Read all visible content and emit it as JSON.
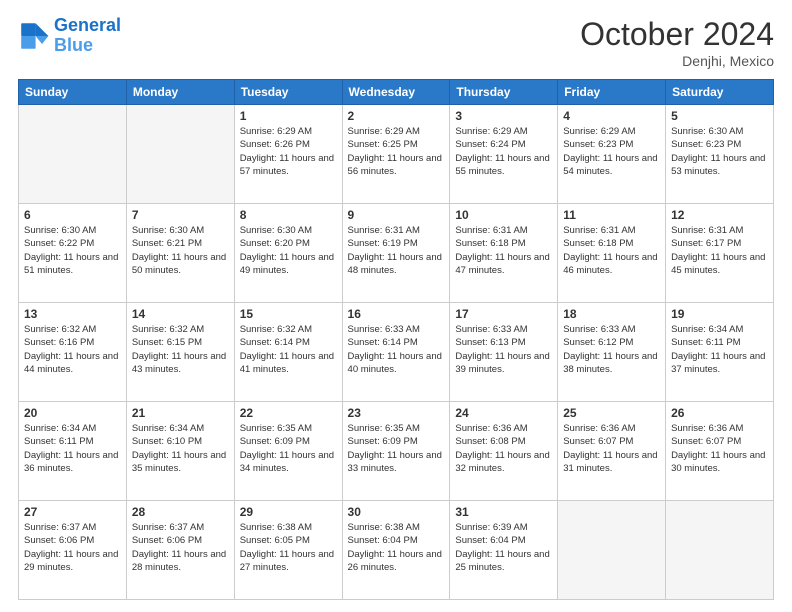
{
  "header": {
    "logo_line1": "General",
    "logo_line2": "Blue",
    "month": "October 2024",
    "location": "Denjhi, Mexico"
  },
  "weekdays": [
    "Sunday",
    "Monday",
    "Tuesday",
    "Wednesday",
    "Thursday",
    "Friday",
    "Saturday"
  ],
  "weeks": [
    [
      {
        "day": "",
        "empty": true
      },
      {
        "day": "",
        "empty": true
      },
      {
        "day": "1",
        "sunrise": "6:29 AM",
        "sunset": "6:26 PM",
        "daylight": "11 hours and 57 minutes."
      },
      {
        "day": "2",
        "sunrise": "6:29 AM",
        "sunset": "6:25 PM",
        "daylight": "11 hours and 56 minutes."
      },
      {
        "day": "3",
        "sunrise": "6:29 AM",
        "sunset": "6:24 PM",
        "daylight": "11 hours and 55 minutes."
      },
      {
        "day": "4",
        "sunrise": "6:29 AM",
        "sunset": "6:23 PM",
        "daylight": "11 hours and 54 minutes."
      },
      {
        "day": "5",
        "sunrise": "6:30 AM",
        "sunset": "6:23 PM",
        "daylight": "11 hours and 53 minutes."
      }
    ],
    [
      {
        "day": "6",
        "sunrise": "6:30 AM",
        "sunset": "6:22 PM",
        "daylight": "11 hours and 51 minutes."
      },
      {
        "day": "7",
        "sunrise": "6:30 AM",
        "sunset": "6:21 PM",
        "daylight": "11 hours and 50 minutes."
      },
      {
        "day": "8",
        "sunrise": "6:30 AM",
        "sunset": "6:20 PM",
        "daylight": "11 hours and 49 minutes."
      },
      {
        "day": "9",
        "sunrise": "6:31 AM",
        "sunset": "6:19 PM",
        "daylight": "11 hours and 48 minutes."
      },
      {
        "day": "10",
        "sunrise": "6:31 AM",
        "sunset": "6:18 PM",
        "daylight": "11 hours and 47 minutes."
      },
      {
        "day": "11",
        "sunrise": "6:31 AM",
        "sunset": "6:18 PM",
        "daylight": "11 hours and 46 minutes."
      },
      {
        "day": "12",
        "sunrise": "6:31 AM",
        "sunset": "6:17 PM",
        "daylight": "11 hours and 45 minutes."
      }
    ],
    [
      {
        "day": "13",
        "sunrise": "6:32 AM",
        "sunset": "6:16 PM",
        "daylight": "11 hours and 44 minutes."
      },
      {
        "day": "14",
        "sunrise": "6:32 AM",
        "sunset": "6:15 PM",
        "daylight": "11 hours and 43 minutes."
      },
      {
        "day": "15",
        "sunrise": "6:32 AM",
        "sunset": "6:14 PM",
        "daylight": "11 hours and 41 minutes."
      },
      {
        "day": "16",
        "sunrise": "6:33 AM",
        "sunset": "6:14 PM",
        "daylight": "11 hours and 40 minutes."
      },
      {
        "day": "17",
        "sunrise": "6:33 AM",
        "sunset": "6:13 PM",
        "daylight": "11 hours and 39 minutes."
      },
      {
        "day": "18",
        "sunrise": "6:33 AM",
        "sunset": "6:12 PM",
        "daylight": "11 hours and 38 minutes."
      },
      {
        "day": "19",
        "sunrise": "6:34 AM",
        "sunset": "6:11 PM",
        "daylight": "11 hours and 37 minutes."
      }
    ],
    [
      {
        "day": "20",
        "sunrise": "6:34 AM",
        "sunset": "6:11 PM",
        "daylight": "11 hours and 36 minutes."
      },
      {
        "day": "21",
        "sunrise": "6:34 AM",
        "sunset": "6:10 PM",
        "daylight": "11 hours and 35 minutes."
      },
      {
        "day": "22",
        "sunrise": "6:35 AM",
        "sunset": "6:09 PM",
        "daylight": "11 hours and 34 minutes."
      },
      {
        "day": "23",
        "sunrise": "6:35 AM",
        "sunset": "6:09 PM",
        "daylight": "11 hours and 33 minutes."
      },
      {
        "day": "24",
        "sunrise": "6:36 AM",
        "sunset": "6:08 PM",
        "daylight": "11 hours and 32 minutes."
      },
      {
        "day": "25",
        "sunrise": "6:36 AM",
        "sunset": "6:07 PM",
        "daylight": "11 hours and 31 minutes."
      },
      {
        "day": "26",
        "sunrise": "6:36 AM",
        "sunset": "6:07 PM",
        "daylight": "11 hours and 30 minutes."
      }
    ],
    [
      {
        "day": "27",
        "sunrise": "6:37 AM",
        "sunset": "6:06 PM",
        "daylight": "11 hours and 29 minutes."
      },
      {
        "day": "28",
        "sunrise": "6:37 AM",
        "sunset": "6:06 PM",
        "daylight": "11 hours and 28 minutes."
      },
      {
        "day": "29",
        "sunrise": "6:38 AM",
        "sunset": "6:05 PM",
        "daylight": "11 hours and 27 minutes."
      },
      {
        "day": "30",
        "sunrise": "6:38 AM",
        "sunset": "6:04 PM",
        "daylight": "11 hours and 26 minutes."
      },
      {
        "day": "31",
        "sunrise": "6:39 AM",
        "sunset": "6:04 PM",
        "daylight": "11 hours and 25 minutes."
      },
      {
        "day": "",
        "empty": true
      },
      {
        "day": "",
        "empty": true
      }
    ]
  ]
}
